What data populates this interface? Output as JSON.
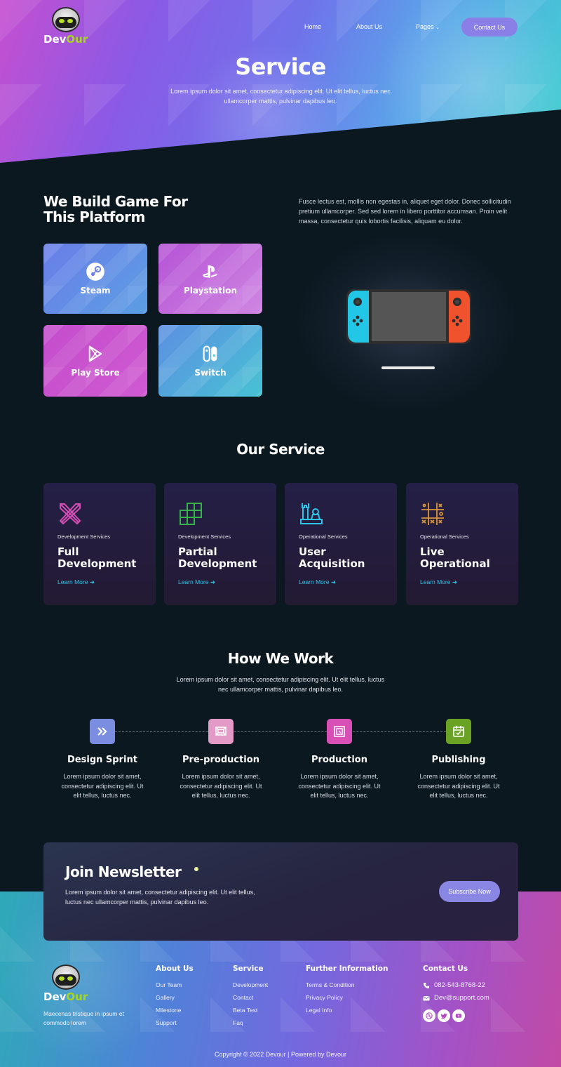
{
  "brand": {
    "part1": "Dev",
    "part2": "Our"
  },
  "nav": {
    "home": "Home",
    "about": "About Us",
    "pages": "Pages",
    "contact_button": "Contact Us"
  },
  "hero": {
    "title": "Service",
    "subtitle": "Lorem ipsum dolor sit amet, consectetur adipiscing elit. Ut elit tellus, luctus nec ullamcorper mattis, pulvinar dapibus leo."
  },
  "platforms": {
    "title_line1": "We Build Game For",
    "title_line2": "This Platform",
    "description": "Fusce lectus est, mollis non egestas in, aliquet eget dolor. Donec sollicitudin pretium ullamcorper. Sed sed lorem in libero porttitor accumsan. Proin velit massa, consectetur quis lobortis facilisis, aliquam eu dolor.",
    "tiles": [
      {
        "label": "Steam",
        "icon": "steam-icon"
      },
      {
        "label": "Playstation",
        "icon": "playstation-icon"
      },
      {
        "label": "Play Store",
        "icon": "play-store-icon"
      },
      {
        "label": "Switch",
        "icon": "switch-icon"
      }
    ]
  },
  "services": {
    "title": "Our Service",
    "cards": [
      {
        "category": "Development Services",
        "title_line1": "Full",
        "title_line2": "Development",
        "link": "Learn More",
        "icon": "crossed-swords-icon"
      },
      {
        "category": "Development Services",
        "title_line1": "Partial",
        "title_line2": "Development",
        "link": "Learn More",
        "icon": "grid-blocks-icon"
      },
      {
        "category": "Operational Services",
        "title_line1": "User",
        "title_line2": "Acquisition",
        "link": "Learn More",
        "icon": "chess-rook-icon"
      },
      {
        "category": "Operational Services",
        "title_line1": "Live",
        "title_line2": "Operational",
        "link": "Learn More",
        "icon": "tic-tac-toe-icon"
      }
    ]
  },
  "how": {
    "title": "How We Work",
    "subtitle": "Lorem ipsum dolor sit amet, consectetur adipiscing elit. Ut elit tellus, luctus nec ullamcorper mattis, pulvinar dapibus leo.",
    "steps": [
      {
        "title": "Design Sprint",
        "text": "Lorem ipsum dolor sit amet, consectetur adipiscing elit. Ut elit tellus, luctus nec.",
        "icon": "double-chevron-icon",
        "color": "#7b8de0"
      },
      {
        "title": "Pre-production",
        "text": "Lorem ipsum dolor sit amet, consectetur adipiscing elit. Ut elit tellus, luctus nec.",
        "icon": "frame-icon",
        "color": "#e49ac6"
      },
      {
        "title": "Production",
        "text": "Lorem ipsum dolor sit amet, consectetur adipiscing elit. Ut elit tellus, luctus nec.",
        "icon": "frame-icon",
        "color": "#d84fb5"
      },
      {
        "title": "Publishing",
        "text": "Lorem ipsum dolor sit amet, consectetur adipiscing elit. Ut elit tellus, luctus nec.",
        "icon": "calendar-check-icon",
        "color": "#6aa324"
      }
    ]
  },
  "newsletter": {
    "title": "Join Newsletter",
    "text": "Lorem ipsum dolor sit amet, consectetur adipiscing elit. Ut elit tellus, luctus nec ullamcorper mattis, pulvinar dapibus leo.",
    "button": "Subscribe Now"
  },
  "footer": {
    "tagline": "Maecenas tristique in ipsum et commodo lorem",
    "about": {
      "title": "About Us",
      "links": [
        "Our Team",
        "Gallery",
        "Milestone",
        "Support"
      ]
    },
    "service": {
      "title": "Service",
      "links": [
        "Development",
        "Contact",
        "Beta Test",
        "Faq"
      ]
    },
    "info": {
      "title": "Further Information",
      "links": [
        "Terms & Condition",
        "Privacy Policy",
        "Legal Info"
      ]
    },
    "contact": {
      "title": "Contact Us",
      "phone": "082-543-8768-22",
      "email": "Dev@support.com"
    },
    "copyright": "Copyright © 2022 Devour | Powered by Devour"
  },
  "colors": {
    "accent": "#8a7fe6",
    "link": "#33c4e8",
    "brand_green": "#a6d61e"
  }
}
